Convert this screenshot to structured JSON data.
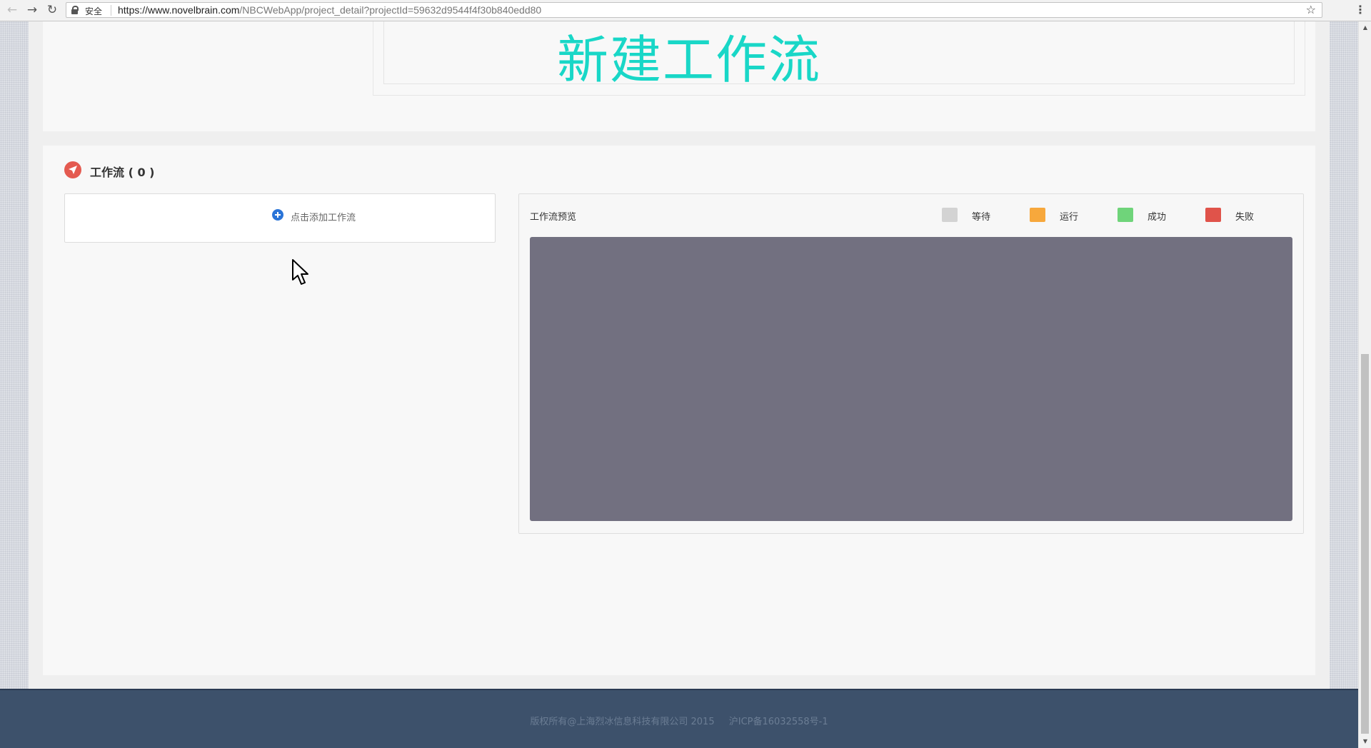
{
  "browser": {
    "back": "←",
    "forward": "→",
    "reload": "↻",
    "secure_label": "安全",
    "url_host": "https://www.novelbrain.com",
    "url_path": "/NBCWebApp/project_detail?projectId=59632d9544f4f30b840edd80",
    "star": "☆",
    "menu": "⋮"
  },
  "upper": {
    "new_workflow_title": "新建工作流"
  },
  "workflow": {
    "title": "工作流 ( 0 )",
    "add_label": "点击添加工作流",
    "preview_title": "工作流预览",
    "legend": [
      {
        "label": "等待",
        "color": "#d3d3d3"
      },
      {
        "label": "运行",
        "color": "#f7a83c"
      },
      {
        "label": "成功",
        "color": "#6fd47a"
      },
      {
        "label": "失败",
        "color": "#e0534a"
      }
    ]
  },
  "footer": {
    "copyright": "版权所有@上海烈冰信息科技有限公司 2015",
    "icp": "沪ICP备16032558号-1"
  },
  "colors": {
    "accent_title": "#19d7c7",
    "canvas": "#727080",
    "footer_bg": "#3d516b"
  }
}
